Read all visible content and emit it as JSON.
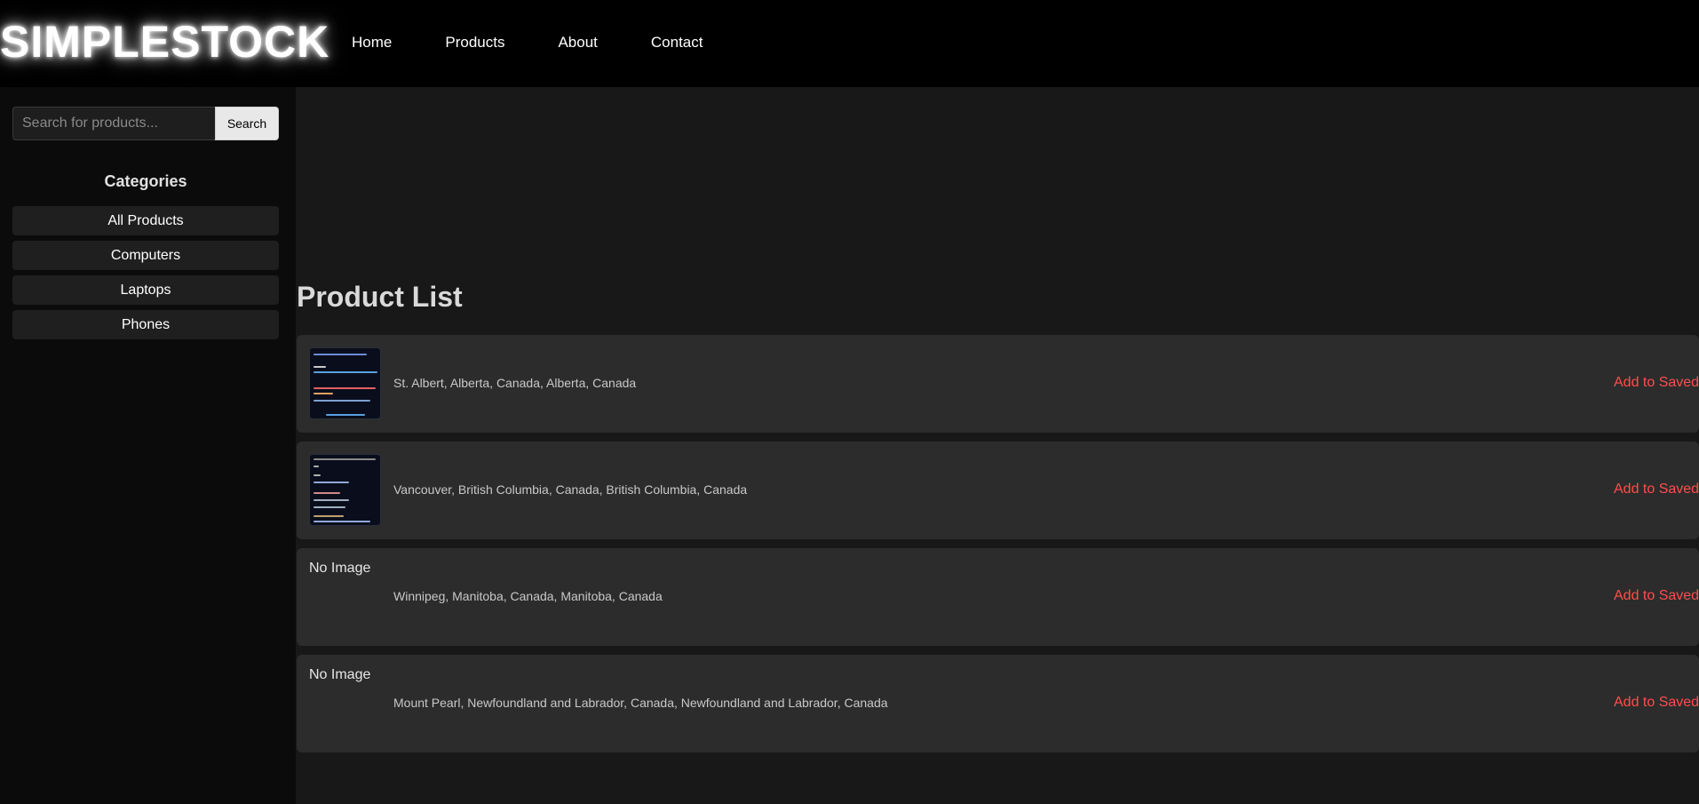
{
  "header": {
    "logo": "SIMPLESTOCK",
    "nav": [
      "Home",
      "Products",
      "About",
      "Contact"
    ]
  },
  "sidebar": {
    "search": {
      "placeholder": "Search for products...",
      "value": "",
      "button_label": "Search"
    },
    "categories_title": "Categories",
    "categories": [
      "All Products",
      "Computers",
      "Laptops",
      "Phones"
    ]
  },
  "main": {
    "title": "Product List",
    "products": [
      {
        "name": "St. Albert, Alberta, Canada, Alberta, Canada",
        "image": "code-screenshot",
        "action": "Add to Saved"
      },
      {
        "name": "Vancouver, British Columbia, Canada, British Columbia, Canada",
        "image": "code-screenshot",
        "action": "Add to Saved"
      },
      {
        "name": "Winnipeg, Manitoba, Canada, Manitoba, Canada",
        "image_alt": "No Image",
        "action": "Add to Saved"
      },
      {
        "name": "Mount Pearl, Newfoundland and Labrador, Canada, Newfoundland and Labrador, Canada",
        "image_alt": "No Image",
        "action": "Add to Saved"
      }
    ]
  },
  "colors": {
    "header_bg": "#000000",
    "sidebar_bg": "#0b0b0b",
    "main_bg": "#181818",
    "row_bg": "#2c2c2c",
    "accent_link": "#ff4d4d"
  }
}
